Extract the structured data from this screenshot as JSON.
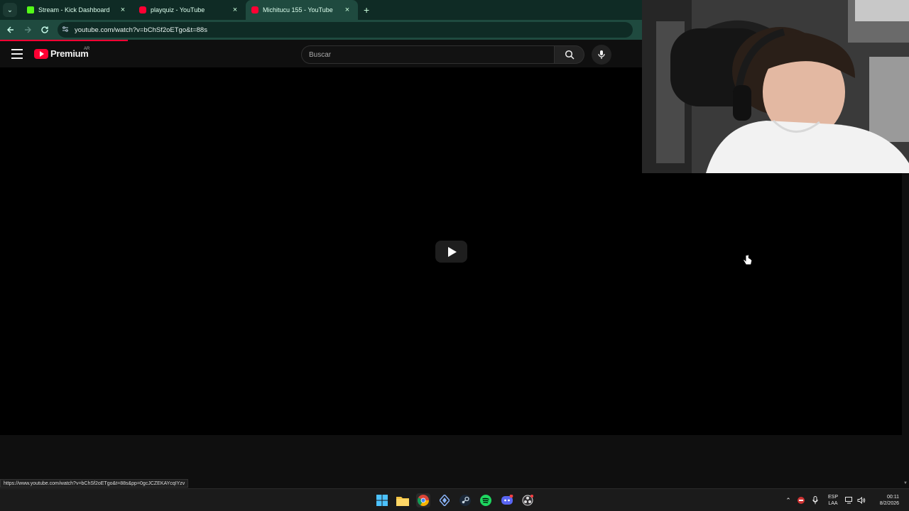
{
  "browser": {
    "tabs": [
      {
        "title": "Stream - Kick Dashboard",
        "favicon": "kick-icon",
        "active": false
      },
      {
        "title": "playquiz - YouTube",
        "favicon": "youtube-icon",
        "active": false
      },
      {
        "title": "Michitucu 155 - YouTube",
        "favicon": "youtube-icon",
        "active": true
      }
    ],
    "close_glyph": "×",
    "new_tab_glyph": "+",
    "url": "youtube.com/watch?v=bChSf2oETgo&t=88s",
    "hover_url": "https://www.youtube.com/watch?v=bChSf2oETgo&t=88s&pp=0gcJCZEKAYcqIYzv",
    "colors": {
      "chrome_dark": "#0f2b25",
      "chrome_light": "#1f4a3f",
      "progress": "#ff0033"
    }
  },
  "youtube": {
    "logo_text": "Premium",
    "region": "AR",
    "search_placeholder": "Buscar",
    "colors": {
      "brand": "#ff0033",
      "background": "#0f0f0f"
    }
  },
  "player": {
    "state": "paused",
    "play_icon": "play-icon"
  },
  "taskbar": {
    "apps": [
      "windows-start-icon",
      "file-explorer-icon",
      "chrome-icon",
      "app-icon",
      "steam-icon",
      "spotify-icon",
      "discord-icon",
      "obs-icon"
    ],
    "tray": {
      "language_line1": "ESP",
      "language_line2": "LAA",
      "time": "00:11",
      "date": "8/2/2026"
    }
  }
}
